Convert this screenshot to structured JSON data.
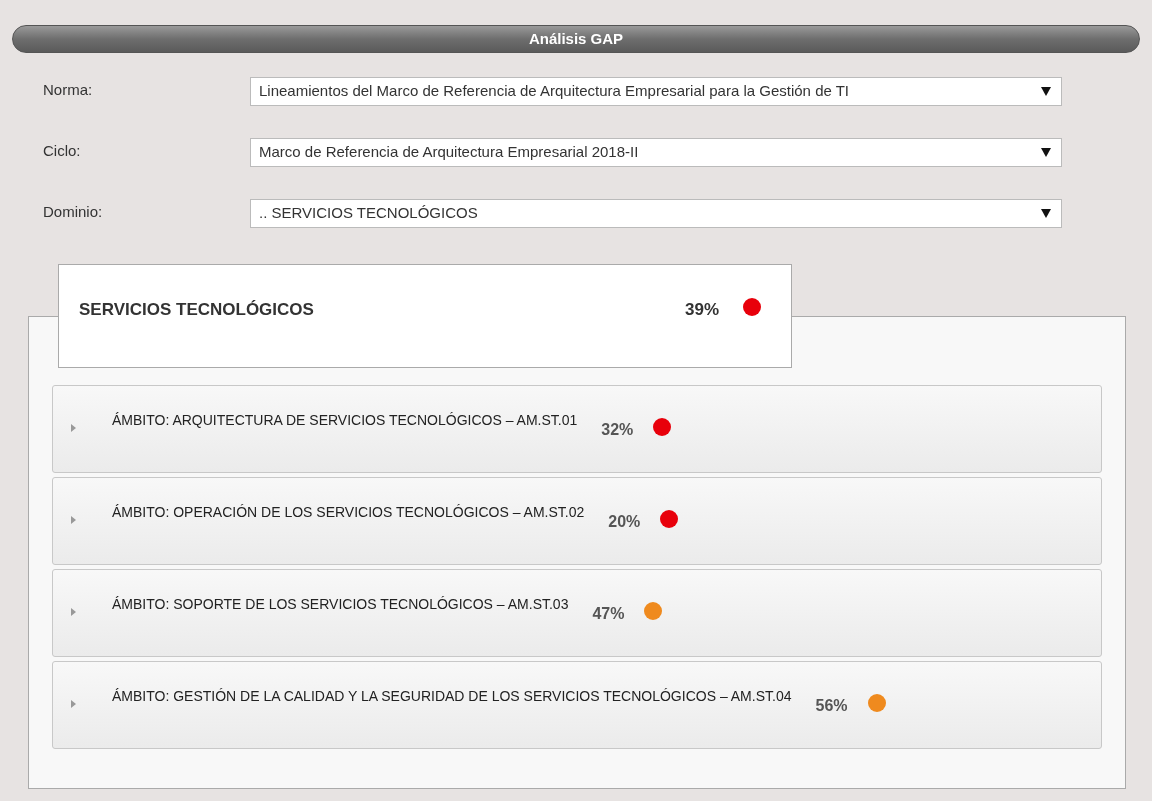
{
  "header": {
    "title": "Análisis GAP"
  },
  "filters": [
    {
      "label": "Norma:",
      "value": "Lineamientos del Marco de Referencia de Arquitectura Empresarial para la Gestión de TI"
    },
    {
      "label": "Ciclo:",
      "value": "Marco de Referencia de Arquitectura Empresarial 2018-II"
    },
    {
      "label": "Dominio:",
      "value": ".. SERVICIOS TECNOLÓGICOS"
    }
  ],
  "domain": {
    "title": "SERVICIOS TECNOLÓGICOS",
    "percent": "39%",
    "color": "#e8000b"
  },
  "scopes": [
    {
      "title": "ÁMBITO: ARQUITECTURA DE SERVICIOS TECNOLÓGICOS – AM.ST.01",
      "percent": "32%",
      "color": "#e8000b",
      "expanded": false
    },
    {
      "title": "ÁMBITO: OPERACIÓN DE LOS SERVICIOS TECNOLÓGICOS – AM.ST.02",
      "percent": "20%",
      "color": "#e8000b",
      "expanded": false
    },
    {
      "title": "ÁMBITO: SOPORTE DE LOS SERVICIOS TECNOLÓGICOS – AM.ST.03",
      "percent": "47%",
      "color": "#ef8a1e",
      "expanded": false
    },
    {
      "title": "ÁMBITO: GESTIÓN DE LA CALIDAD Y LA SEGURIDAD DE LOS SERVICIOS TECNOLÓGICOS – AM.ST.04",
      "percent": "56%",
      "color": "#ef8a1e",
      "expanded": false
    }
  ]
}
